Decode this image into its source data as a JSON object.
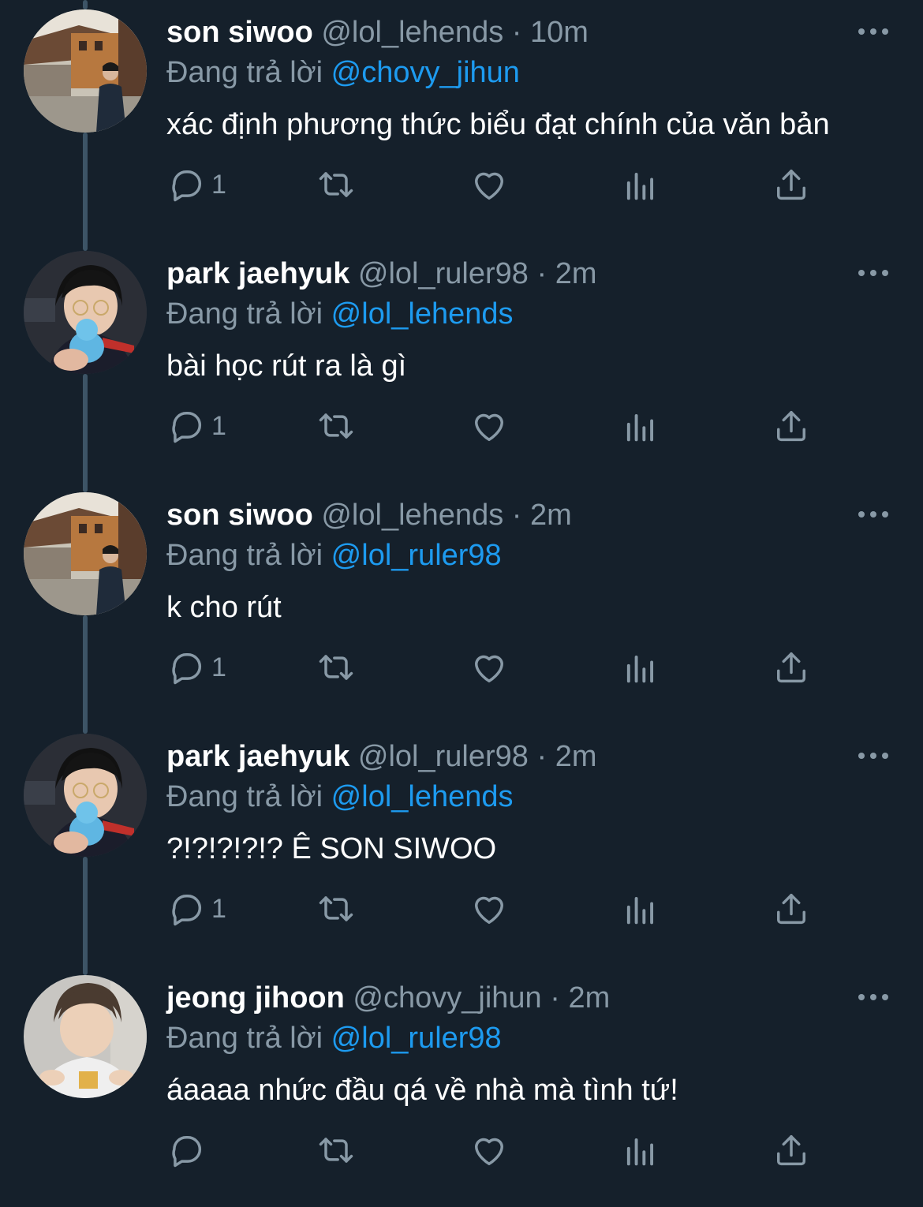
{
  "reply_prefix": "Đang trả lời",
  "separator": "·",
  "colors": {
    "background": "#15202b",
    "text_primary": "#ffffff",
    "text_secondary": "#8899a6",
    "mention": "#1d9bf0",
    "thread_line": "#3d5466"
  },
  "icons": {
    "reply": "reply-icon",
    "retweet": "retweet-icon",
    "like": "like-icon",
    "stats": "stats-icon",
    "share": "share-icon",
    "more": "more-icon"
  },
  "tweets": [
    {
      "name": "son siwoo",
      "handle": "@lol_lehends",
      "time": "10m",
      "reply_to": "@chovy_jihun",
      "text": "xác định phương thức biểu đạt chính của văn bản",
      "reply_count": "1"
    },
    {
      "name": "park jaehyuk",
      "handle": "@lol_ruler98",
      "time": "2m",
      "reply_to": "@lol_lehends",
      "text": "bài học rút ra là gì",
      "reply_count": "1"
    },
    {
      "name": "son siwoo",
      "handle": "@lol_lehends",
      "time": "2m",
      "reply_to": "@lol_ruler98",
      "text": "k cho rút",
      "reply_count": "1"
    },
    {
      "name": "park jaehyuk",
      "handle": "@lol_ruler98",
      "time": "2m",
      "reply_to": "@lol_lehends",
      "text": "?!?!?!?!? Ê SON SIWOO",
      "reply_count": "1"
    },
    {
      "name": "jeong jihoon",
      "handle": "@chovy_jihun",
      "time": "2m",
      "reply_to": "@lol_ruler98",
      "text": "áaaaa nhức đầu qá về nhà mà tình tứ!",
      "reply_count": ""
    }
  ]
}
